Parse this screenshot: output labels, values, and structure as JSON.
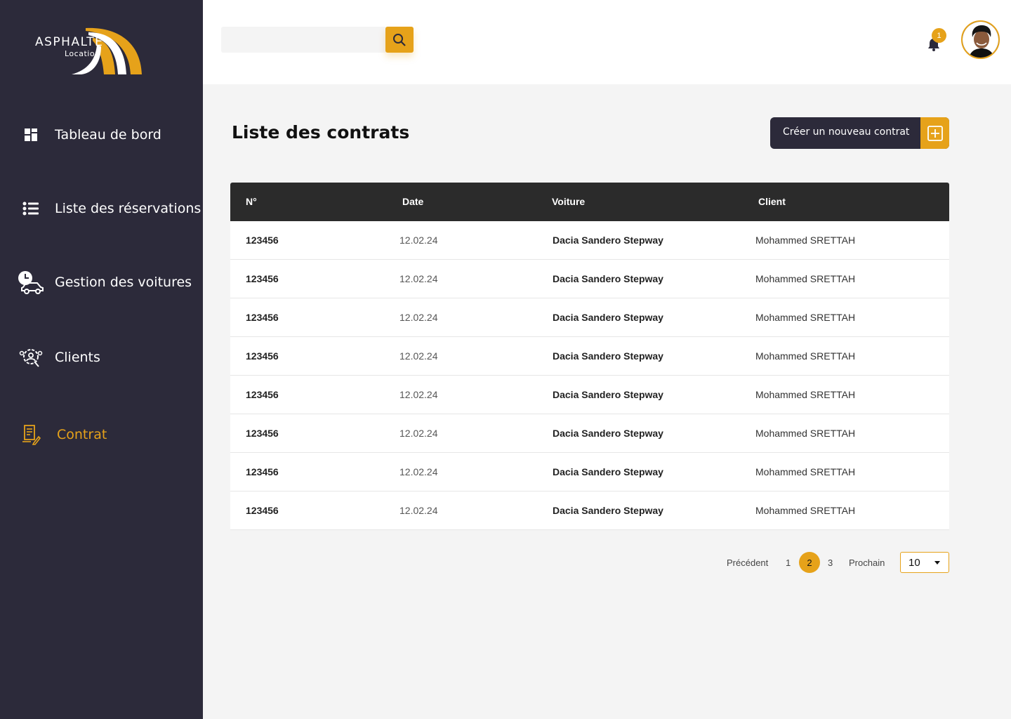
{
  "brand": {
    "name": "ASPHALTE",
    "subtitle": "Location",
    "accent_color": "#e6a21a",
    "sidebar_color": "#2c2a3a"
  },
  "sidebar": {
    "items": [
      {
        "label": "Tableau de bord",
        "icon": "dashboard-icon",
        "active": false
      },
      {
        "label": "Liste des réservations",
        "icon": "list-icon",
        "active": false
      },
      {
        "label": "Gestion des  voitures",
        "icon": "car-clock-icon",
        "active": false
      },
      {
        "label": "Clients",
        "icon": "clients-gear-icon",
        "active": false
      },
      {
        "label": "Contrat",
        "icon": "contract-icon",
        "active": true
      }
    ]
  },
  "header": {
    "search": {
      "value": "",
      "placeholder": ""
    },
    "notifications_count": "1"
  },
  "main": {
    "title": "Liste des contrats",
    "create_button_label": "Créer un nouveau contrat",
    "table": {
      "columns": [
        "N°",
        "Date",
        "Voiture",
        "Client"
      ],
      "rows": [
        [
          "123456",
          "12.02.24",
          "Dacia Sandero Stepway",
          "Mohammed SRETTAH"
        ],
        [
          "123456",
          "12.02.24",
          "Dacia Sandero Stepway",
          "Mohammed SRETTAH"
        ],
        [
          "123456",
          "12.02.24",
          "Dacia Sandero Stepway",
          "Mohammed SRETTAH"
        ],
        [
          "123456",
          "12.02.24",
          "Dacia Sandero Stepway",
          "Mohammed SRETTAH"
        ],
        [
          "123456",
          "12.02.24",
          "Dacia Sandero Stepway",
          "Mohammed SRETTAH"
        ],
        [
          "123456",
          "12.02.24",
          "Dacia Sandero Stepway",
          "Mohammed SRETTAH"
        ],
        [
          "123456",
          "12.02.24",
          "Dacia Sandero Stepway",
          "Mohammed SRETTAH"
        ],
        [
          "123456",
          "12.02.24",
          "Dacia Sandero Stepway",
          "Mohammed SRETTAH"
        ]
      ]
    },
    "pagination": {
      "previous": "Précédent",
      "pages": [
        "1",
        "2",
        "3"
      ],
      "current": "2",
      "next": "Prochain",
      "per_page": "10"
    }
  }
}
